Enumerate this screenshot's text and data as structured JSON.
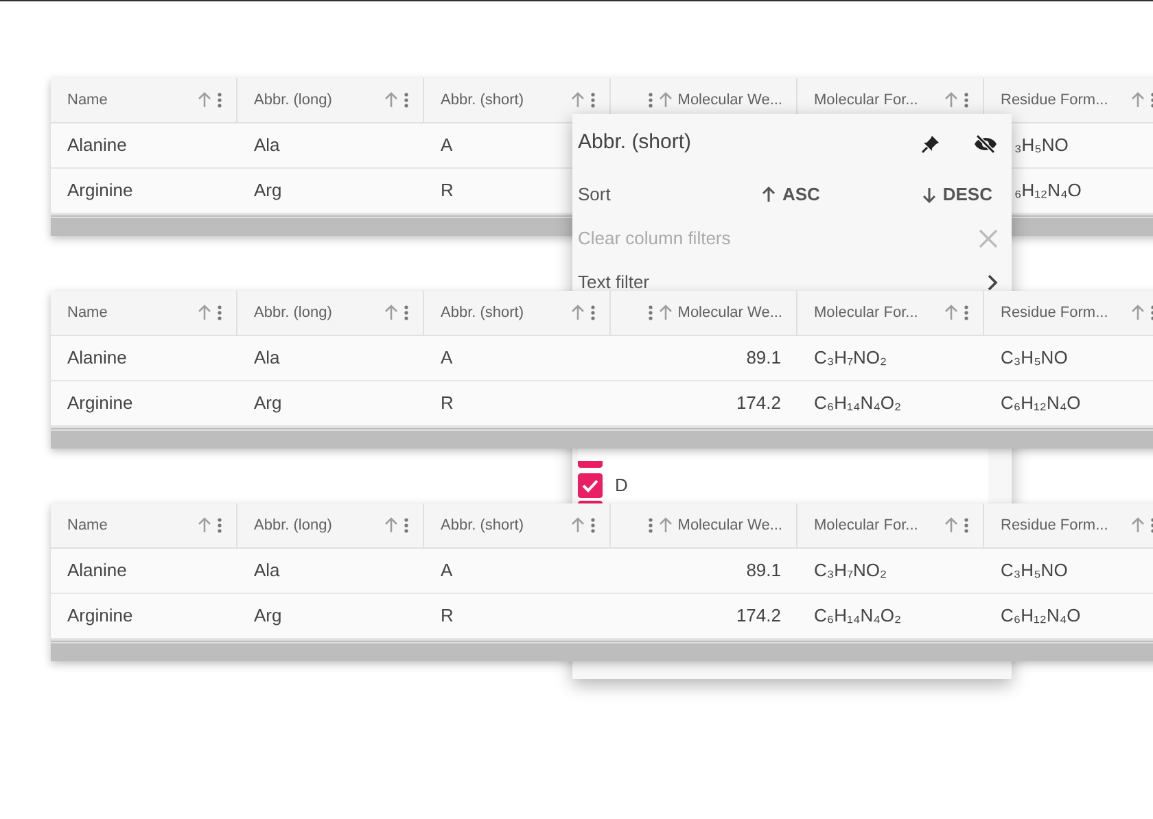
{
  "grids": [
    {
      "columns": [
        {
          "label": "Name",
          "kind": "text"
        },
        {
          "label": "Abbr. (long)",
          "kind": "text"
        },
        {
          "label": "Abbr. (short)",
          "kind": "text"
        },
        {
          "label": "Molecular We...",
          "kind": "numeric"
        },
        {
          "label": "Molecular For...",
          "kind": "text"
        },
        {
          "label": "Residue Form...",
          "kind": "text"
        }
      ],
      "rows": [
        {
          "cells": [
            "Alanine",
            "Ala",
            "A",
            null,
            null,
            "₃H₅NO"
          ]
        },
        {
          "cells": [
            "Arginine",
            "Arg",
            "R",
            null,
            null,
            "₆H₁₂N₄O"
          ]
        }
      ]
    },
    {
      "columns": [
        {
          "label": "Name",
          "kind": "text"
        },
        {
          "label": "Abbr. (long)",
          "kind": "text"
        },
        {
          "label": "Abbr. (short)",
          "kind": "text"
        },
        {
          "label": "Molecular We...",
          "kind": "numeric"
        },
        {
          "label": "Molecular For...",
          "kind": "text"
        },
        {
          "label": "Residue Form...",
          "kind": "text"
        }
      ],
      "rows": [
        {
          "cells": [
            "Alanine",
            "Ala",
            "A",
            "89.1",
            "C₃H₇NO₂",
            "C₃H₅NO"
          ]
        },
        {
          "cells": [
            "Arginine",
            "Arg",
            "R",
            "174.2",
            "C₆H₁₄N₄O₂",
            "C₆H₁₂N₄O"
          ]
        }
      ]
    },
    {
      "columns": [
        {
          "label": "Name",
          "kind": "text"
        },
        {
          "label": "Abbr. (long)",
          "kind": "text"
        },
        {
          "label": "Abbr. (short)",
          "kind": "text"
        },
        {
          "label": "Molecular We...",
          "kind": "numeric"
        },
        {
          "label": "Molecular For...",
          "kind": "text"
        },
        {
          "label": "Residue Form...",
          "kind": "text"
        }
      ],
      "rows": [
        {
          "cells": [
            "Alanine",
            "Ala",
            "A",
            "89.1",
            "C₃H₇NO₂",
            "C₃H₅NO"
          ]
        },
        {
          "cells": [
            "Arginine",
            "Arg",
            "R",
            "174.2",
            "C₆H₁₄N₄O₂",
            "C₆H₁₂N₄O"
          ]
        }
      ]
    }
  ],
  "column_menu": {
    "title": "Abbr. (short)",
    "sort_label": "Sort",
    "asc": "ASC",
    "desc": "DESC",
    "clear_filters": {
      "label": "Clear column filters",
      "disabled": true
    },
    "text_filter": "Text filter",
    "values": [
      {
        "checked": true
      },
      {
        "label": "D",
        "checked": true
      },
      {
        "checked": true
      }
    ]
  }
}
